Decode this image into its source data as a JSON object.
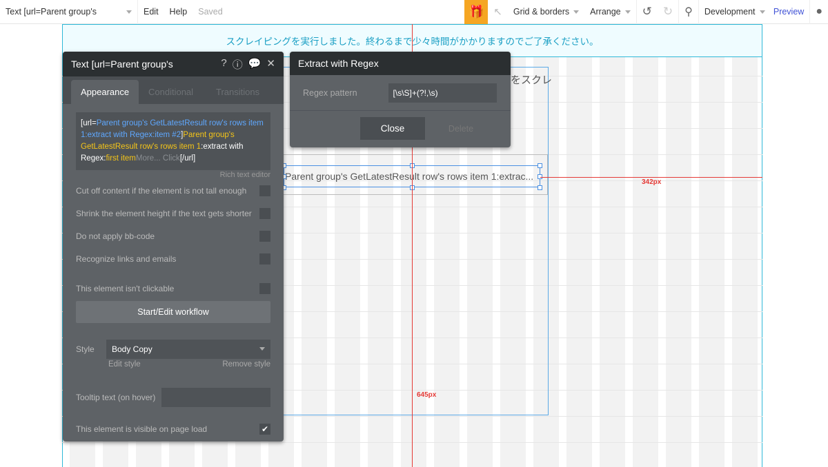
{
  "topbar": {
    "element_select": "Text [url=Parent group's",
    "edit": "Edit",
    "help": "Help",
    "saved": "Saved",
    "grid": "Grid & borders",
    "arrange": "Arrange",
    "dev": "Development",
    "preview": "Preview",
    "accent": "#f5a623"
  },
  "canvas": {
    "banner": "スクレイピングを実行しました。終わるまで少々時間がかかりますのでご了承ください。",
    "bg_text_1": "をスクレ",
    "selected_text": "Parent group's GetLatestResult row's rows item 1:extrac...",
    "dist_v": "645px"
  },
  "panel": {
    "title": "Text [url=Parent group's",
    "tabs": [
      "Appearance",
      "Conditional",
      "Transitions"
    ],
    "expr": {
      "p1": "[url=",
      "p2": "Parent group's GetLatestResult row's rows item 1:extract with Regex:item #2",
      "p3": "]",
      "p4": "Parent group's GetLatestResult row's rows item 1",
      "p5": ":extract with Regex:",
      "p6": "first item",
      "p7": "More...",
      "p8": " Click",
      "p9": "[/url]"
    },
    "rich": "Rich text editor",
    "options": [
      "Cut off content if the element is not tall enough",
      "Shrink the element height if the text gets shorter",
      "Do not apply bb-code",
      "Recognize links and emails",
      "This element isn't clickable"
    ],
    "workflow": "Start/Edit workflow",
    "style_label": "Style",
    "style_value": "Body Copy",
    "edit_style": "Edit style",
    "remove_style": "Remove style",
    "tooltip_label": "Tooltip text (on hover)",
    "tooltip_value": "",
    "visible": "This element is visible on page load",
    "visible_checked": true
  },
  "dialog": {
    "title": "Extract with Regex",
    "pattern_label": "Regex pattern",
    "pattern": "[\\s\\S]+(?!,\\s)",
    "close": "Close",
    "delete": "Delete"
  }
}
